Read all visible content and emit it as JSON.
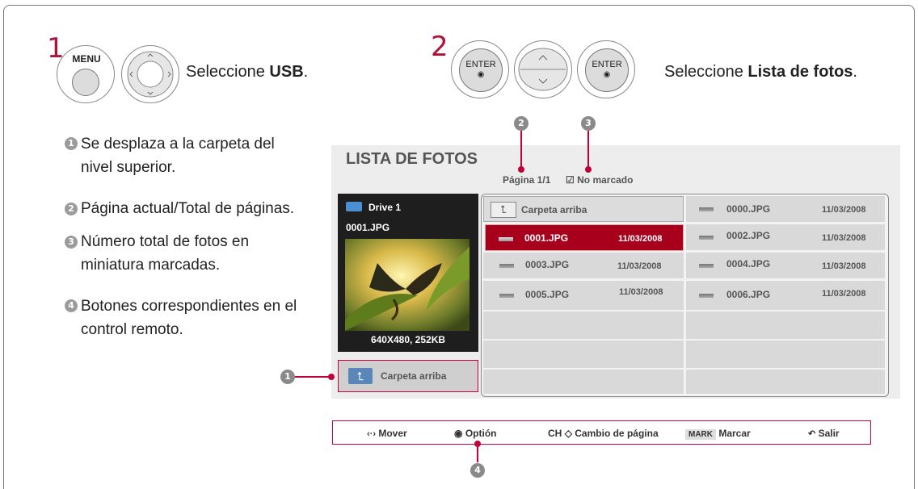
{
  "step1": {
    "number": "1",
    "menu_label": "MENU",
    "instruction_prefix": "Seleccione ",
    "instruction_target": "USB",
    "instruction_suffix": "."
  },
  "step2": {
    "number": "2",
    "enter_label_1": "ENTER",
    "enter_label_2": "ENTER",
    "instruction_prefix": "Seleccione ",
    "instruction_target": "Lista de fotos",
    "instruction_suffix": "."
  },
  "notes": [
    {
      "num": "1",
      "text": "Se desplaza a la carpeta del nivel superior."
    },
    {
      "num": "2",
      "text": "Página actual/Total de páginas."
    },
    {
      "num": "3",
      "text": "Número total de fotos en miniatura marcadas."
    },
    {
      "num": "4",
      "text": "Botones correspondientes en el control remoto."
    }
  ],
  "screen": {
    "title": "LISTA DE FOTOS",
    "page_info": "Página 1/1",
    "mark_info": "No marcado",
    "drive": "Drive 1",
    "selected_file": "0001.JPG",
    "photo_info": "640X480, 252KB",
    "up_folder_left": "Carpeta arriba",
    "up_folder_list": "Carpeta arriba",
    "files": [
      {
        "name": "0000.JPG",
        "date": "11/03/2008"
      },
      {
        "name": "0001.JPG",
        "date": "11/03/2008"
      },
      {
        "name": "0002.JPG",
        "date": "11/03/2008"
      },
      {
        "name": "0003.JPG",
        "date": "11/03/2008"
      },
      {
        "name": "0004.JPG",
        "date": "11/03/2008"
      },
      {
        "name": "0005.JPG",
        "date": "11/03/2008"
      },
      {
        "name": "0006.JPG",
        "date": "11/03/2008"
      }
    ]
  },
  "callouts": {
    "c1": "1",
    "c2": "2",
    "c3": "3",
    "c4": "4"
  },
  "bottom_bar": {
    "move": "Mover",
    "option": "Optión",
    "ch": "CH",
    "page_change": "Cambio de página",
    "mark_key": "MARK",
    "mark": "Marcar",
    "exit": "Salir"
  },
  "colors": {
    "accent": "#b0123a",
    "selected_row": "#a8001c"
  }
}
